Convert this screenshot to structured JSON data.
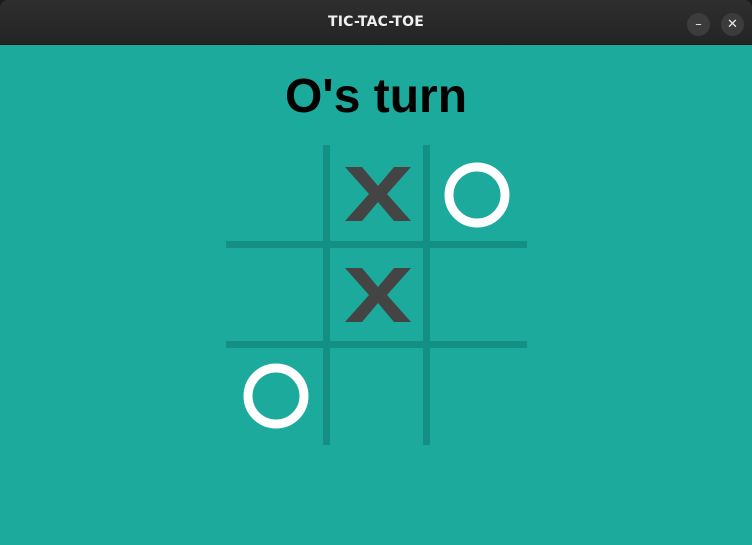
{
  "window": {
    "title": "TIC-TAC-TOE",
    "minimize_label": "–",
    "close_label": "✕"
  },
  "game": {
    "status": "O's turn",
    "board": [
      "",
      "X",
      "O",
      "",
      "X",
      "",
      "O",
      "",
      ""
    ],
    "x_color": "#444444",
    "o_color": "#ffffff",
    "background_color": "#1baa9c",
    "grid_color": "#138f84"
  }
}
